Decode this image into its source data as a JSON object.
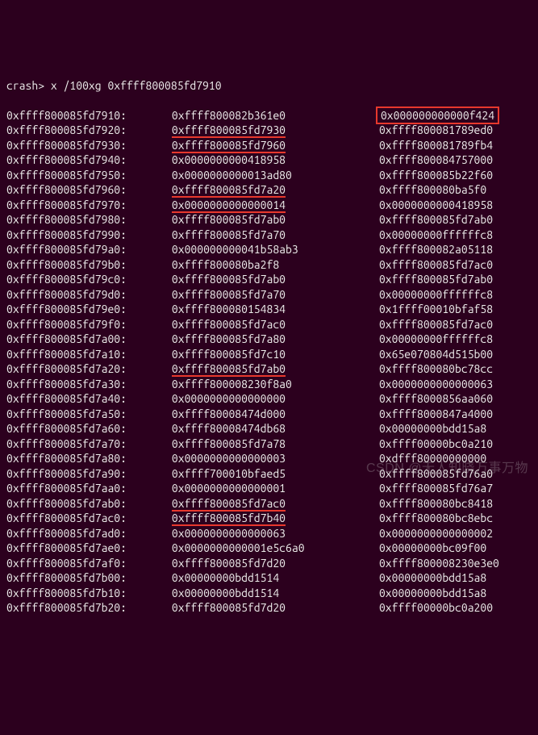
{
  "prompt": "crash> ",
  "command": "x /100xg 0xffff800085fd7910",
  "rows": [
    {
      "addr": "0xffff800085fd7910:",
      "c1": "0xffff800082b361e0",
      "c2": "0x000000000000f424",
      "hl1": "",
      "hl2": "box"
    },
    {
      "addr": "0xffff800085fd7920:",
      "c1": "0xffff800085fd7930",
      "c2": "0xffff800081789ed0",
      "hl1": "u",
      "hl2": ""
    },
    {
      "addr": "0xffff800085fd7930:",
      "c1": "0xffff800085fd7960",
      "c2": "0xffff800081789fb4",
      "hl1": "u",
      "hl2": ""
    },
    {
      "addr": "0xffff800085fd7940:",
      "c1": "0x0000000000418958",
      "c2": "0xffff800084757000",
      "hl1": "",
      "hl2": ""
    },
    {
      "addr": "0xffff800085fd7950:",
      "c1": "0x0000000000013ad80",
      "c2": "0xffff800085b22f60",
      "hl1": "",
      "hl2": ""
    },
    {
      "addr": "0xffff800085fd7960:",
      "c1": "0xffff800085fd7a20",
      "c2": "0xffff800080ba5f0",
      "hl1": "u",
      "hl2": ""
    },
    {
      "addr": "0xffff800085fd7970:",
      "c1": "0x0000000000000014",
      "c2": "0x0000000000418958",
      "hl1": "u",
      "hl2": ""
    },
    {
      "addr": "0xffff800085fd7980:",
      "c1": "0xffff800085fd7ab0",
      "c2": "0xffff800085fd7ab0",
      "hl1": "",
      "hl2": ""
    },
    {
      "addr": "0xffff800085fd7990:",
      "c1": "0xffff800085fd7a70",
      "c2": "0x00000000ffffffc8",
      "hl1": "",
      "hl2": ""
    },
    {
      "addr": "0xffff800085fd79a0:",
      "c1": "0x000000000041b58ab3",
      "c2": "0xffff800082a05118",
      "hl1": "",
      "hl2": ""
    },
    {
      "addr": "0xffff800085fd79b0:",
      "c1": "0xffff800080ba2f8",
      "c2": "0xffff800085fd7ac0",
      "hl1": "",
      "hl2": ""
    },
    {
      "addr": "0xffff800085fd79c0:",
      "c1": "0xffff800085fd7ab0",
      "c2": "0xffff800085fd7ab0",
      "hl1": "",
      "hl2": ""
    },
    {
      "addr": "0xffff800085fd79d0:",
      "c1": "0xffff800085fd7a70",
      "c2": "0x00000000ffffffc8",
      "hl1": "",
      "hl2": ""
    },
    {
      "addr": "0xffff800085fd79e0:",
      "c1": "0xffff800080154834",
      "c2": "0x1ffff00010bfaf58",
      "hl1": "",
      "hl2": ""
    },
    {
      "addr": "0xffff800085fd79f0:",
      "c1": "0xffff800085fd7ac0",
      "c2": "0xffff800085fd7ac0",
      "hl1": "",
      "hl2": ""
    },
    {
      "addr": "0xffff800085fd7a00:",
      "c1": "0xffff800085fd7a80",
      "c2": "0x00000000ffffffc8",
      "hl1": "",
      "hl2": ""
    },
    {
      "addr": "0xffff800085fd7a10:",
      "c1": "0xffff800085fd7c10",
      "c2": "0x65e070804d515b00",
      "hl1": "",
      "hl2": ""
    },
    {
      "addr": "0xffff800085fd7a20:",
      "c1": "0xffff800085fd7ab0",
      "c2": "0xffff800080bc78cc",
      "hl1": "u",
      "hl2": ""
    },
    {
      "addr": "0xffff800085fd7a30:",
      "c1": "0xffff800008230f8a0",
      "c2": "0x0000000000000063",
      "hl1": "",
      "hl2": ""
    },
    {
      "addr": "0xffff800085fd7a40:",
      "c1": "0x0000000000000000",
      "c2": "0xffff8000856aa060",
      "hl1": "",
      "hl2": ""
    },
    {
      "addr": "0xffff800085fd7a50:",
      "c1": "0xffff80008474d000",
      "c2": "0xffff8000847a4000",
      "hl1": "",
      "hl2": ""
    },
    {
      "addr": "0xffff800085fd7a60:",
      "c1": "0xffff80008474db68",
      "c2": "0x00000000bdd15a8",
      "hl1": "",
      "hl2": ""
    },
    {
      "addr": "0xffff800085fd7a70:",
      "c1": "0xffff800085fd7a78",
      "c2": "0xffff00000bc0a210",
      "hl1": "",
      "hl2": ""
    },
    {
      "addr": "0xffff800085fd7a80:",
      "c1": "0x0000000000000003",
      "c2": "0xdfff80000000000",
      "hl1": "",
      "hl2": ""
    },
    {
      "addr": "0xffff800085fd7a90:",
      "c1": "0xffff700010bfaed5",
      "c2": "0xffff800085fd76a0",
      "hl1": "",
      "hl2": ""
    },
    {
      "addr": "0xffff800085fd7aa0:",
      "c1": "0x0000000000000001",
      "c2": "0xffff800085fd76a7",
      "hl1": "",
      "hl2": ""
    },
    {
      "addr": "0xffff800085fd7ab0:",
      "c1": "0xffff800085fd7ac0",
      "c2": "0xffff800080bc8418",
      "hl1": "u",
      "hl2": ""
    },
    {
      "addr": "0xffff800085fd7ac0:",
      "c1": "0xffff800085fd7b40",
      "c2": "0xffff800080bc8ebc",
      "hl1": "u",
      "hl2": ""
    },
    {
      "addr": "0xffff800085fd7ad0:",
      "c1": "0x0000000000000063",
      "c2": "0x0000000000000002",
      "hl1": "",
      "hl2": ""
    },
    {
      "addr": "0xffff800085fd7ae0:",
      "c1": "0x0000000000001e5c6a0",
      "c2": "0x00000000bc09f00",
      "hl1": "",
      "hl2": ""
    },
    {
      "addr": "0xffff800085fd7af0:",
      "c1": "0xffff800085fd7d20",
      "c2": "0xffff800008230e3e0",
      "hl1": "",
      "hl2": ""
    },
    {
      "addr": "0xffff800085fd7b00:",
      "c1": "0x00000000bdd1514",
      "c2": "0x00000000bdd15a8",
      "hl1": "",
      "hl2": ""
    },
    {
      "addr": "0xffff800085fd7b10:",
      "c1": "0x00000000bdd1514",
      "c2": "0x00000000bdd15a8",
      "hl1": "",
      "hl2": ""
    },
    {
      "addr": "0xffff800085fd7b20:",
      "c1": "0xffff800085fd7d20",
      "c2": "0xffff00000bc0a200",
      "hl1": "",
      "hl2": ""
    }
  ],
  "watermark": "CSDN @无人知晓万事万物"
}
